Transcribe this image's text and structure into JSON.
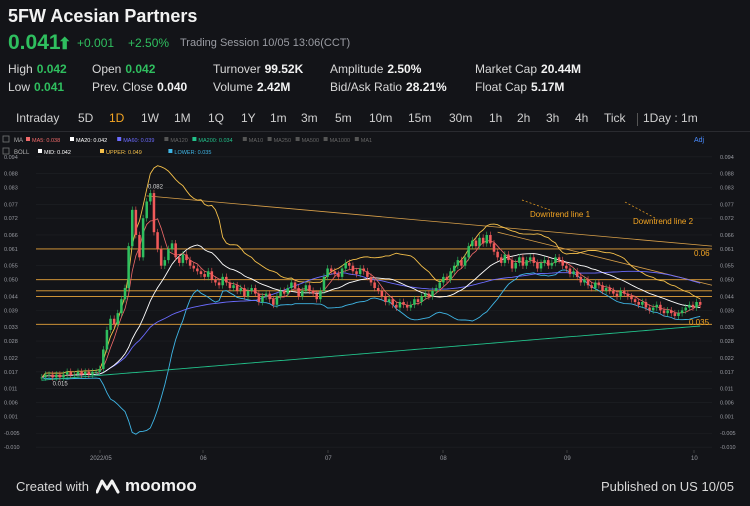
{
  "header": {
    "title": "5FW Acesian Partners",
    "price": "0.041",
    "change": "+0.001",
    "change_pct": "+2.50%",
    "session": "Trading Session  10/05 13:06(CCT)"
  },
  "stats": {
    "high_label": "High",
    "high": "0.042",
    "low_label": "Low",
    "low": "0.041",
    "open_label": "Open",
    "open": "0.042",
    "prev_label": "Prev. Close",
    "prev": "0.040",
    "turnover_label": "Turnover",
    "turnover": "99.52K",
    "volume_label": "Volume",
    "volume": "2.42M",
    "amplitude_label": "Amplitude",
    "amplitude": "2.50%",
    "bidask_label": "Bid/Ask Ratio",
    "bidask": "28.21%",
    "mcap_label": "Market Cap",
    "mcap": "20.44M",
    "float_label": "Float Cap",
    "float": "5.17M"
  },
  "tabs": [
    "Intraday",
    "5D",
    "1D",
    "1W",
    "1M",
    "1Q",
    "1Y",
    "1m",
    "3m",
    "5m",
    "10m",
    "15m",
    "30m",
    "1h",
    "2h",
    "3h",
    "4h",
    "Tick"
  ],
  "active_tab": "1D",
  "interval": "1Day : 1m",
  "indicators": {
    "ma_label": "MA",
    "ma_items": [
      {
        "label": "MA5: 0.038",
        "color": "#f06a6a"
      },
      {
        "label": "MA20: 0.042",
        "color": "#ffffff"
      },
      {
        "label": "MA60: 0.039",
        "color": "#6b6bff"
      },
      {
        "label": "MA120",
        "color": "#555555"
      },
      {
        "label": "MA200: 0.034",
        "color": "#22c08a"
      },
      {
        "label": "MA10",
        "color": "#555555"
      },
      {
        "label": "MA250",
        "color": "#555555"
      },
      {
        "label": "MA500",
        "color": "#555555"
      },
      {
        "label": "MA1000",
        "color": "#555555"
      },
      {
        "label": "MA1",
        "color": "#555555"
      }
    ],
    "boll_label": "BOLL",
    "boll_items": [
      {
        "label": "MID: 0.042",
        "color": "#ffffff"
      },
      {
        "label": "UPPER: 0.049",
        "color": "#f5c04a"
      },
      {
        "label": "LOWER: 0.035",
        "color": "#3fb6e6"
      }
    ],
    "adj": "Adj"
  },
  "chart_data": {
    "type": "candlestick",
    "y_ticks": [
      "0.094",
      "0.088",
      "0.083",
      "0.077",
      "0.072",
      "0.066",
      "0.061",
      "0.055",
      "0.050",
      "0.044",
      "0.039",
      "0.033",
      "0.028",
      "0.022",
      "0.017",
      "0.011",
      "0.006",
      "0.001",
      "-0.005",
      "-0.010"
    ],
    "ylim": [
      -0.011,
      0.095
    ],
    "x_labels": [
      "2022/05",
      "06",
      "07",
      "08",
      "09",
      "10"
    ],
    "horizontal_levels": [
      0.061,
      0.05,
      0.046,
      0.044,
      0.034
    ],
    "annotations": [
      {
        "text": "0.082"
      },
      {
        "text": "0.015"
      },
      {
        "text": "Downtrend line 1"
      },
      {
        "text": "Downtrend line 2"
      },
      {
        "text": "0.06"
      },
      {
        "text": "0.035"
      }
    ],
    "closes": [
      0.015,
      0.016,
      0.016,
      0.015,
      0.016,
      0.015,
      0.016,
      0.017,
      0.016,
      0.016,
      0.017,
      0.016,
      0.017,
      0.016,
      0.017,
      0.017,
      0.018,
      0.025,
      0.032,
      0.036,
      0.034,
      0.038,
      0.043,
      0.047,
      0.062,
      0.075,
      0.066,
      0.058,
      0.072,
      0.078,
      0.081,
      0.067,
      0.061,
      0.055,
      0.057,
      0.061,
      0.063,
      0.058,
      0.056,
      0.059,
      0.057,
      0.055,
      0.054,
      0.053,
      0.052,
      0.051,
      0.053,
      0.05,
      0.049,
      0.048,
      0.051,
      0.049,
      0.047,
      0.048,
      0.046,
      0.047,
      0.044,
      0.046,
      0.047,
      0.045,
      0.042,
      0.044,
      0.045,
      0.043,
      0.041,
      0.044,
      0.046,
      0.045,
      0.047,
      0.049,
      0.047,
      0.044,
      0.046,
      0.048,
      0.046,
      0.045,
      0.043,
      0.046,
      0.051,
      0.054,
      0.053,
      0.052,
      0.051,
      0.054,
      0.056,
      0.055,
      0.053,
      0.052,
      0.054,
      0.053,
      0.051,
      0.049,
      0.047,
      0.046,
      0.044,
      0.042,
      0.043,
      0.041,
      0.04,
      0.042,
      0.041,
      0.04,
      0.041,
      0.043,
      0.042,
      0.044,
      0.045,
      0.044,
      0.046,
      0.047,
      0.049,
      0.051,
      0.05,
      0.053,
      0.055,
      0.057,
      0.055,
      0.058,
      0.062,
      0.064,
      0.062,
      0.065,
      0.063,
      0.066,
      0.063,
      0.06,
      0.058,
      0.056,
      0.059,
      0.057,
      0.054,
      0.056,
      0.058,
      0.055,
      0.057,
      0.058,
      0.056,
      0.054,
      0.056,
      0.057,
      0.055,
      0.056,
      0.058,
      0.057,
      0.055,
      0.054,
      0.052,
      0.053,
      0.051,
      0.049,
      0.05,
      0.048,
      0.047,
      0.049,
      0.048,
      0.046,
      0.047,
      0.046,
      0.045,
      0.044,
      0.046,
      0.045,
      0.044,
      0.043,
      0.042,
      0.041,
      0.042,
      0.04,
      0.039,
      0.04,
      0.041,
      0.039,
      0.038,
      0.039,
      0.038,
      0.037,
      0.038,
      0.039,
      0.04,
      0.041,
      0.04,
      0.042,
      0.041
    ]
  },
  "footer": {
    "created": "Created with",
    "brand": "moomoo",
    "published": "Published on US 10/05"
  }
}
